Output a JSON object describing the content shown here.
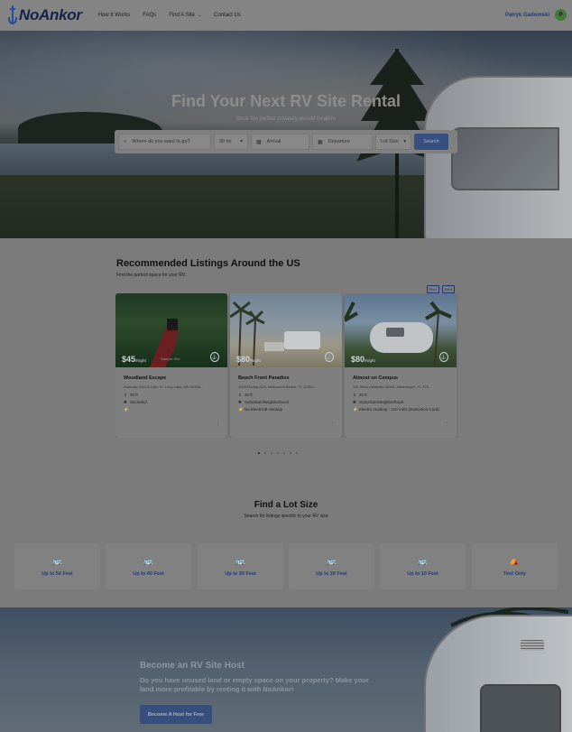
{
  "header": {
    "logo_text": "NoAnkor",
    "nav": [
      {
        "label": "How It Works"
      },
      {
        "label": "FAQs"
      },
      {
        "label": "Find A Site",
        "chevron": "chevron-down-icon"
      },
      {
        "label": "Contact Us"
      }
    ],
    "user_name": "Patryk Gadomski",
    "avatar_initial": "P"
  },
  "hero": {
    "title": "Find Your Next RV Site Rental",
    "subtitle": "Book the perfect privately-owned location",
    "search": {
      "where_placeholder": "Where do you want to go?",
      "distance_value": "30 mi",
      "arrival_placeholder": "Arrival",
      "departure_placeholder": "Departure",
      "lot_size_value": "Lot Size",
      "button_label": "Search"
    }
  },
  "listings": {
    "title": "Recommended Listings Around the US",
    "subtitle": "Find the perfect space for your RV.",
    "prev_label": "Prev",
    "next_label": "Next",
    "cards": [
      {
        "price": "$45",
        "per": "/Night",
        "image_caption": "Sample Site",
        "title": "Woodland Escape",
        "address": "Roanoke Blvd & Lake St, Long Lake, MN 55356...",
        "length": "30 ft",
        "type": "Secluded",
        "hookup": ""
      },
      {
        "price": "$80",
        "per": "/Night",
        "title": "Beach Front Paradise",
        "address": "4005 Florida A1A, Melbourne Beach, FL 32951...",
        "length": "30 ft",
        "type": "Suburban/Neighborhood",
        "hookup": "No Electrical Hookup"
      },
      {
        "price": "$80",
        "per": "/Night",
        "title": "Almost on Campus",
        "address": "130 West Lafayette Street, Tallahassee, FL 323...",
        "length": "40 ft",
        "type": "Suburban/Neighborhood",
        "hookup": "Electric Hookup - 110 Volts (Extension Cord)"
      }
    ],
    "dots_count": 7,
    "active_dot": 0
  },
  "lots": {
    "title": "Find a Lot Size",
    "subtitle": "Search for listings specific to your RV size",
    "items": [
      {
        "label": "Up to 50 Feet",
        "icon": "rv-icon"
      },
      {
        "label": "Up to 40 Feet",
        "icon": "rv-icon"
      },
      {
        "label": "Up to 30 Feet",
        "icon": "rv-icon"
      },
      {
        "label": "Up to 20 Feet",
        "icon": "rv-icon"
      },
      {
        "label": "Up to 10 Feet",
        "icon": "rv-icon"
      },
      {
        "label": "Tent Only",
        "icon": "tent-icon"
      }
    ]
  },
  "host": {
    "title": "Become an RV Site Host",
    "text": "Do you have unused land or empty space on your property? Make your land more profitable by renting it with NoAnkor!",
    "button_label": "Become A Host for Free"
  }
}
